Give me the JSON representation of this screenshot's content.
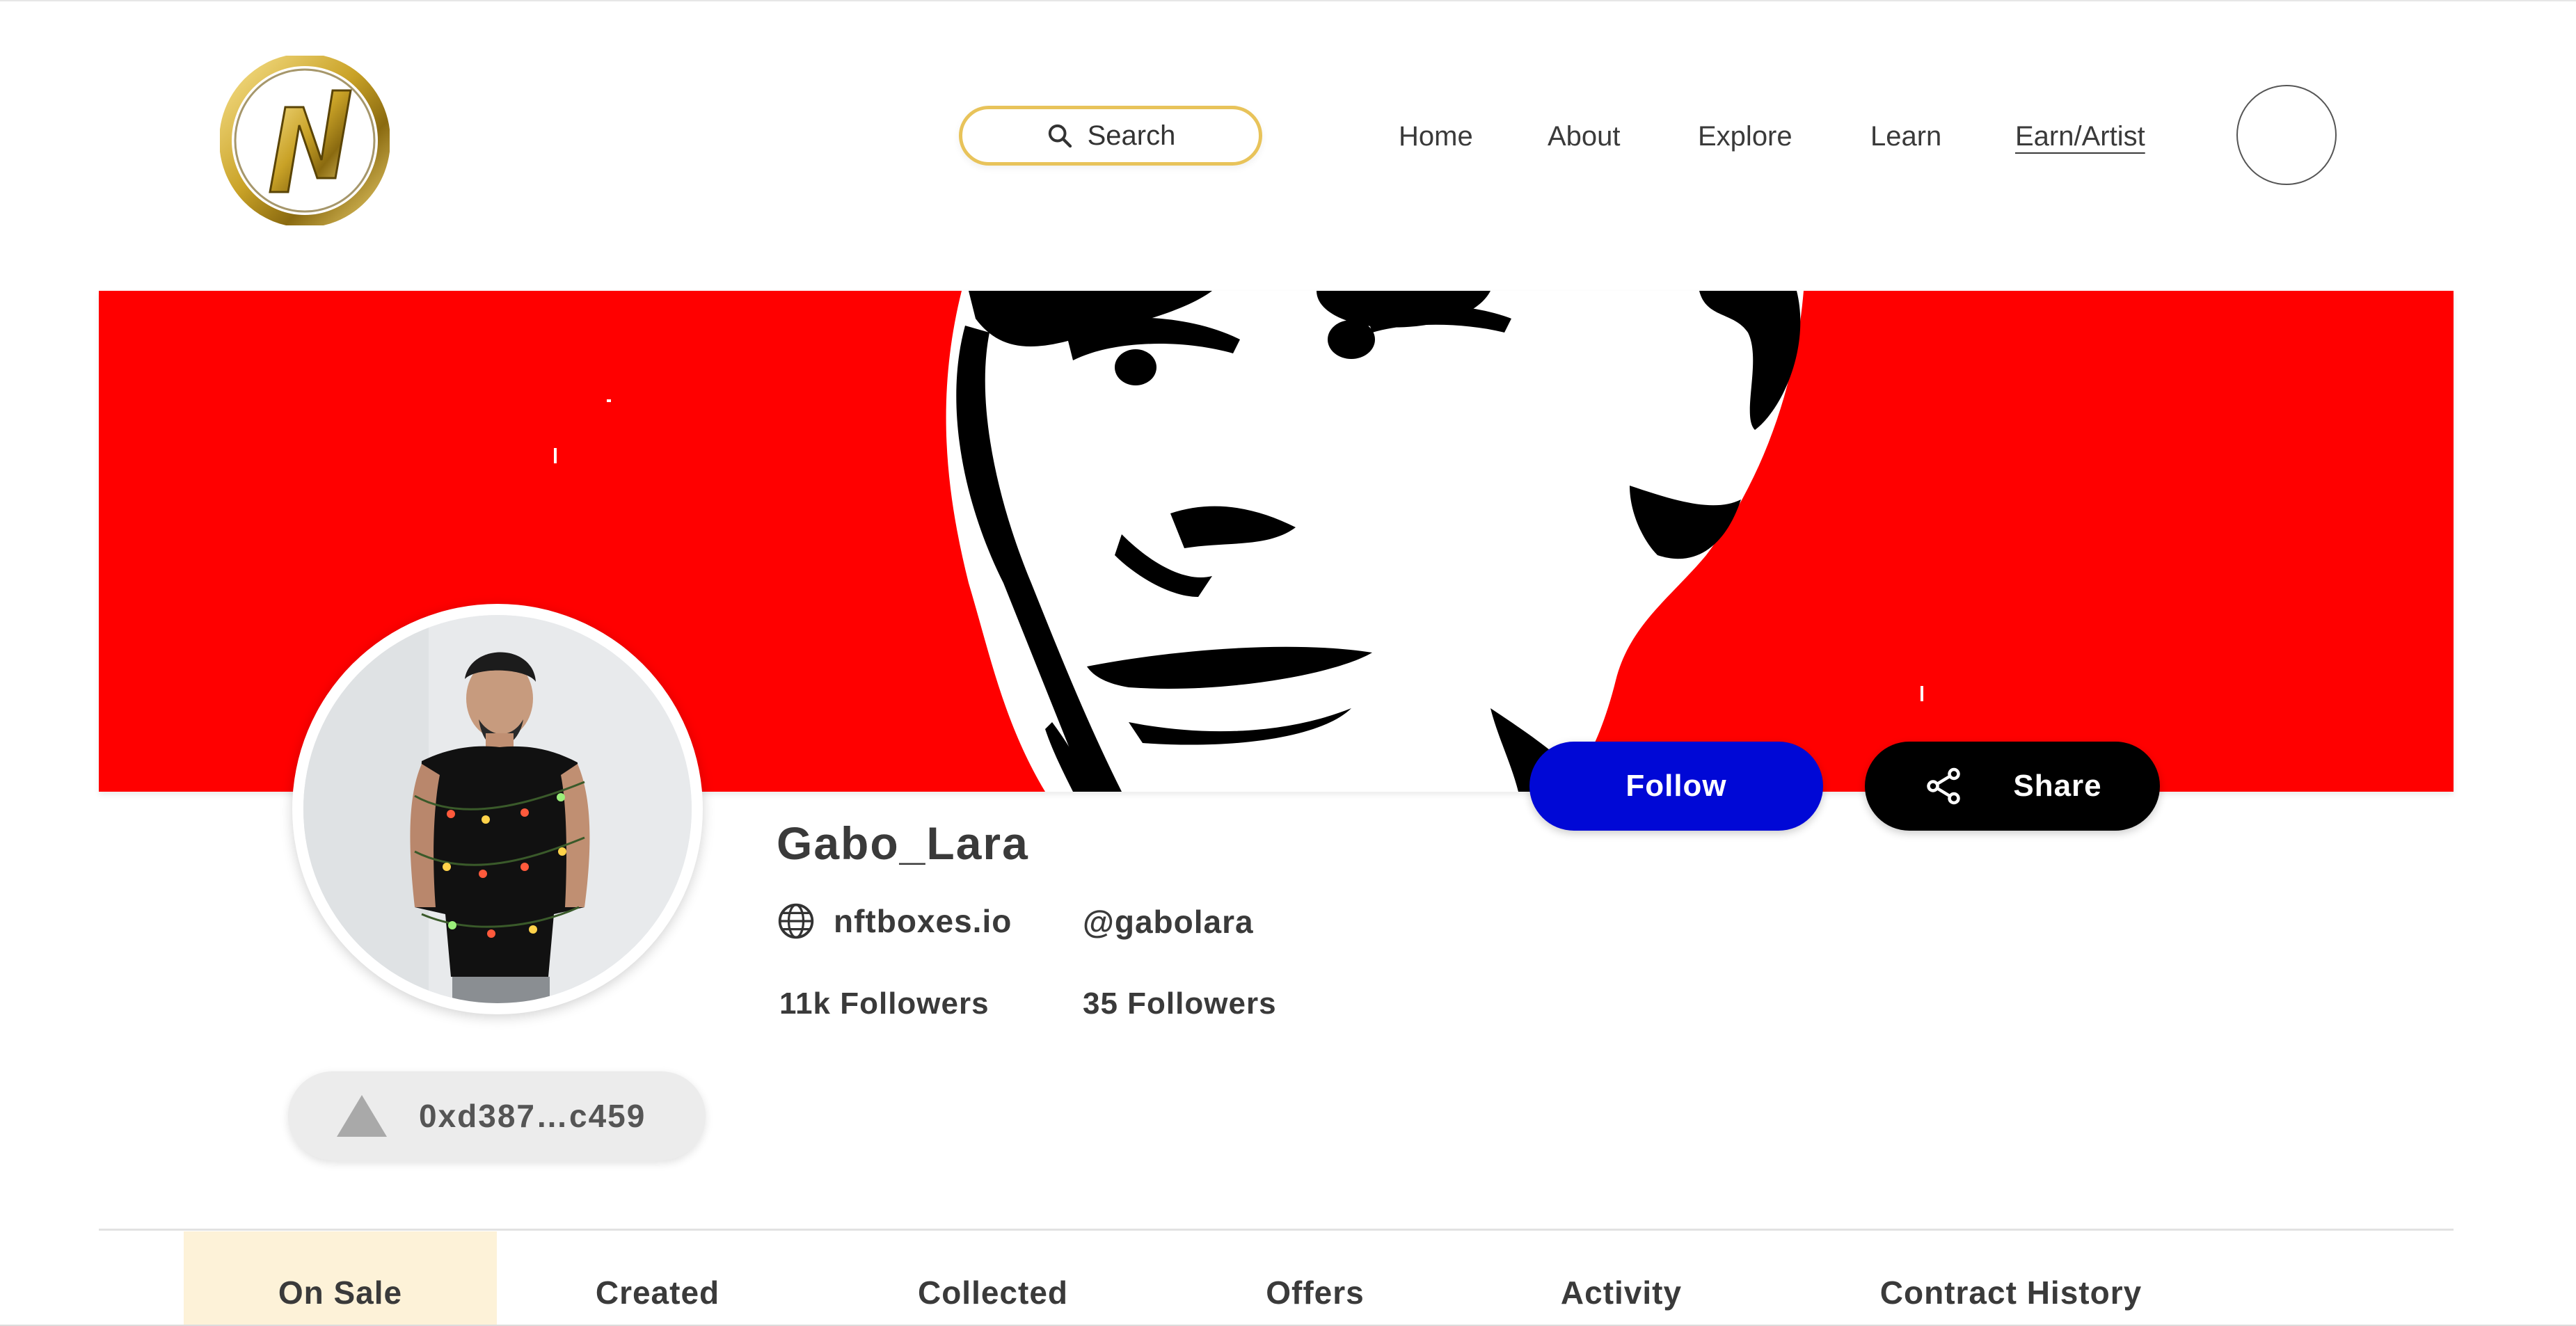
{
  "header": {
    "search_label": "Search",
    "nav": [
      {
        "label": "Home"
      },
      {
        "label": "About"
      },
      {
        "label": "Explore"
      },
      {
        "label": "Learn"
      },
      {
        "label": "Earn/Artist"
      }
    ]
  },
  "profile": {
    "username": "Gabo_Lara",
    "website": "nftboxes.io",
    "handle": "@gabolara",
    "followers_primary": "11k Followers",
    "followers_secondary": "35 Followers",
    "wallet": "0xd387…c459"
  },
  "actions": {
    "follow_label": "Follow",
    "share_label": "Share"
  },
  "tabs": [
    {
      "label": "On Sale",
      "active": true
    },
    {
      "label": "Created"
    },
    {
      "label": "Collected"
    },
    {
      "label": "Offers"
    },
    {
      "label": "Activity"
    },
    {
      "label": "Contract History"
    }
  ],
  "colors": {
    "banner": "#ff0000",
    "follow": "#0008d6",
    "share": "#000000",
    "search_border": "#e8c35a",
    "active_tab": "#fdf2d8"
  }
}
